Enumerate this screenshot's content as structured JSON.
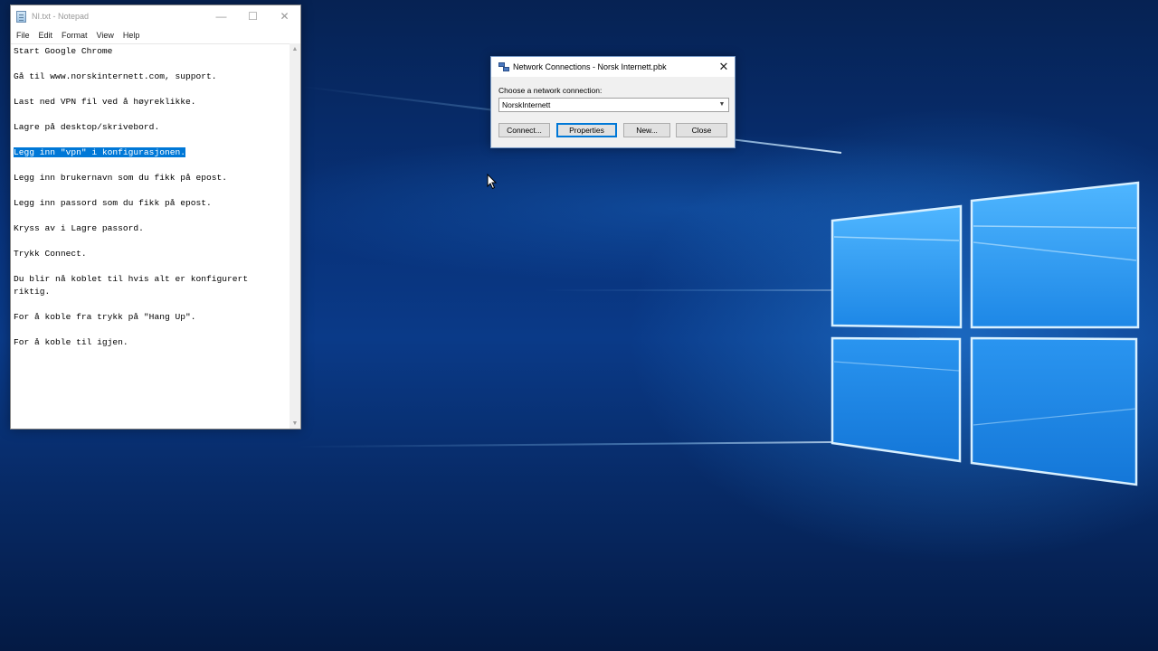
{
  "notepad": {
    "title": "NI.txt - Notepad",
    "controls": {
      "minimize": "—",
      "maximize": "☐",
      "close": "✕"
    },
    "menu": [
      "File",
      "Edit",
      "Format",
      "View",
      "Help"
    ],
    "lines": [
      "Start Google Chrome",
      "",
      "Gå til www.norskinternett.com, support.",
      "",
      "Last ned VPN fil ved å høyreklikke.",
      "",
      "Lagre på desktop/skrivebord.",
      "",
      "Legg inn \"vpn\" i konfigurasjonen.",
      "",
      "Legg inn brukernavn som du fikk på epost.",
      "",
      "Legg inn passord som du fikk på epost.",
      "",
      "Kryss av i Lagre passord.",
      "",
      "Trykk Connect.",
      "",
      "Du blir nå koblet til hvis alt er konfigurert",
      "riktig.",
      "",
      "For å koble fra trykk på \"Hang Up\".",
      "",
      "For å koble til igjen."
    ],
    "selected_line_index": 8
  },
  "dialog": {
    "title": "Network Connections - Norsk Internett.pbk",
    "close": "✕",
    "label": "Choose a network connection:",
    "selected_connection": "NorskInternett",
    "buttons": {
      "connect": "Connect...",
      "properties": "Properties",
      "new": "New...",
      "close": "Close"
    }
  },
  "colors": {
    "selection": "#0078d7",
    "desktop_dark": "#062253",
    "desktop_glow": "#288ceb"
  }
}
